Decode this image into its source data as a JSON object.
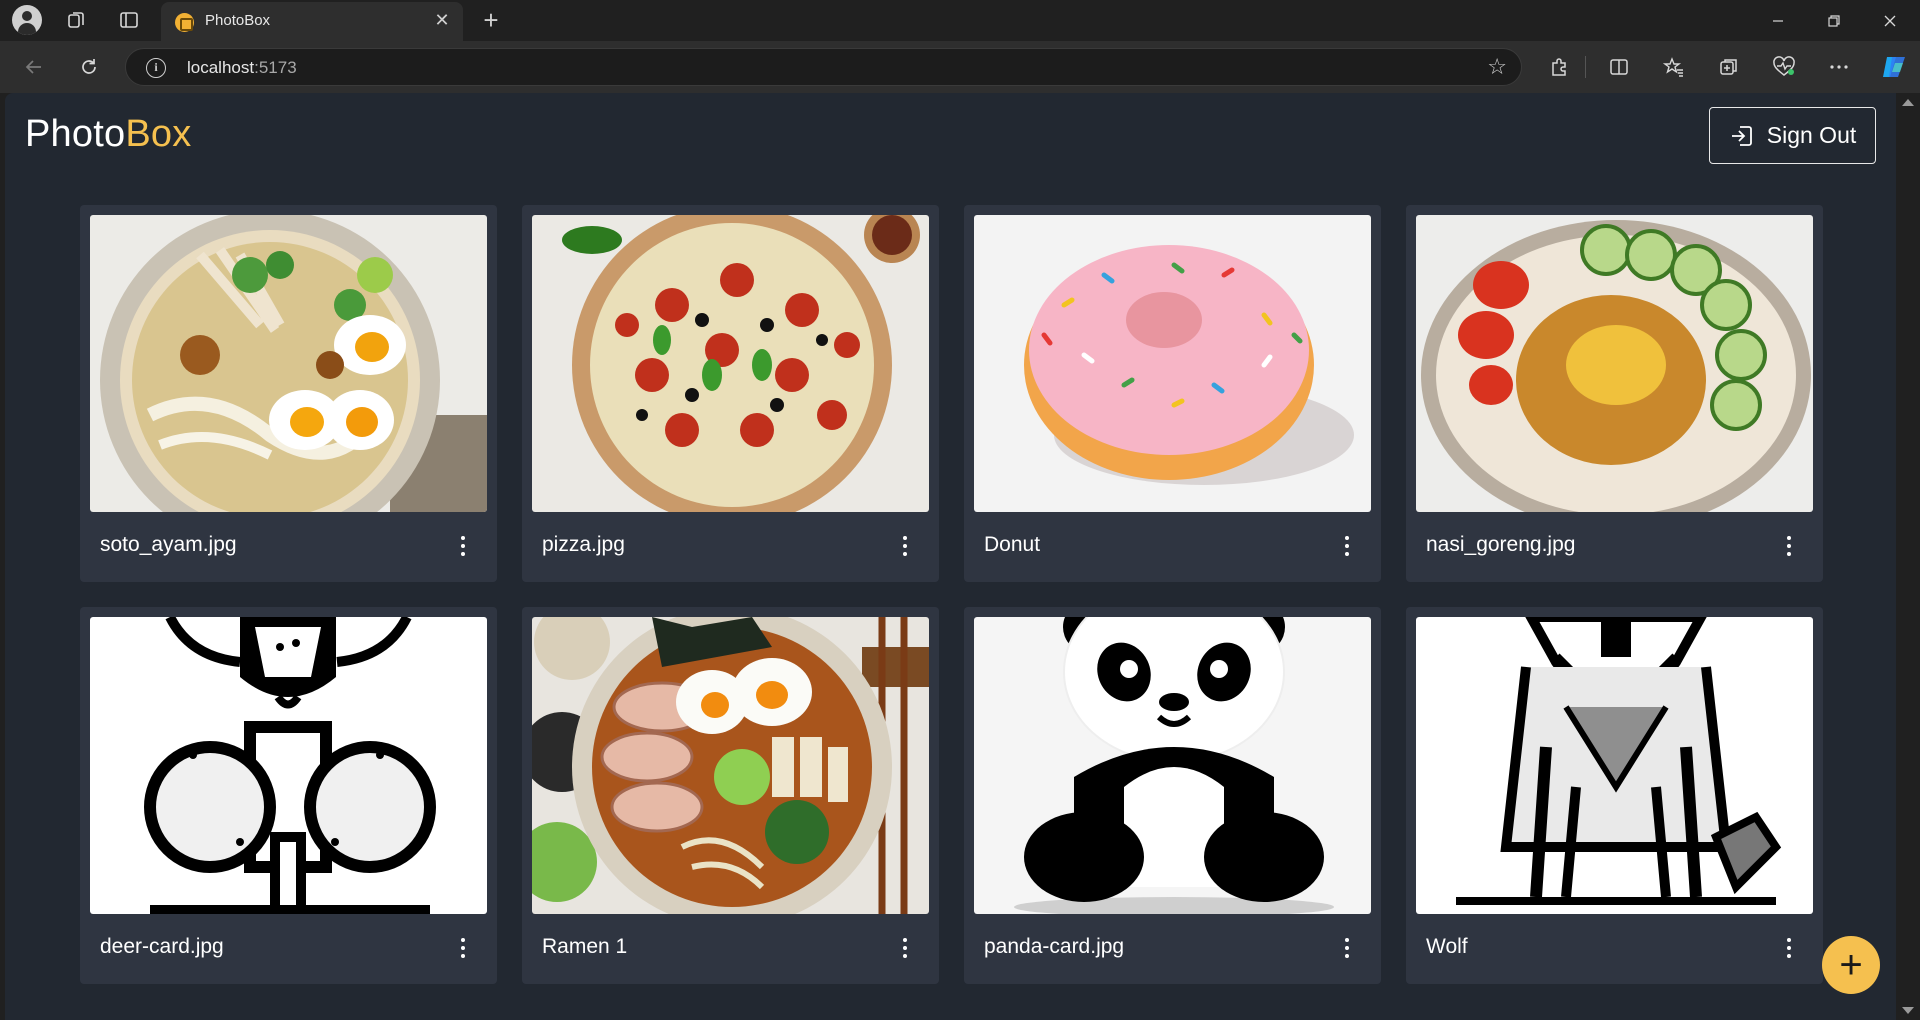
{
  "browser": {
    "tab_title": "PhotoBox",
    "url_host": "localhost",
    "url_port": ":5173",
    "icons": [
      "profile-icon",
      "workspaces-icon",
      "vertical-tabs-icon",
      "tab-close-icon",
      "new-tab-icon",
      "minimize-icon",
      "restore-icon",
      "close-window-icon",
      "back-icon",
      "reload-icon",
      "site-info-icon",
      "favorite-star-icon",
      "extensions-icon",
      "split-screen-icon",
      "favorites-icon",
      "collections-icon",
      "browser-essentials-icon",
      "more-icon",
      "copilot-icon"
    ]
  },
  "app": {
    "brand_primary": "Photo",
    "brand_accent": "Box",
    "signout_label": "Sign Out",
    "add_label": "+",
    "accent_color": "#f5c04f",
    "background_color": "#222831",
    "card_color": "#2f3541"
  },
  "photos": [
    {
      "label": "soto_ayam.jpg",
      "image": "soto-ayam-photo"
    },
    {
      "label": "pizza.jpg",
      "image": "pizza-photo"
    },
    {
      "label": "Donut",
      "image": "donut-photo"
    },
    {
      "label": "nasi_goreng.jpg",
      "image": "nasi-goreng-photo"
    },
    {
      "label": "deer-card.jpg",
      "image": "deer-illustration"
    },
    {
      "label": "Ramen 1",
      "image": "ramen-photo"
    },
    {
      "label": "panda-card.jpg",
      "image": "panda-illustration"
    },
    {
      "label": "Wolf",
      "image": "wolf-illustration"
    }
  ]
}
